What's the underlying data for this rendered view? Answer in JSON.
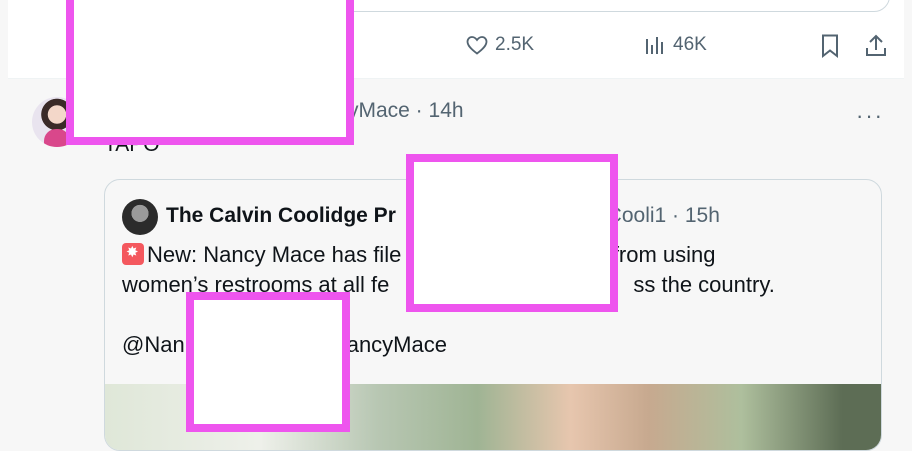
{
  "previous_post": {
    "likes": "2.5K",
    "views": "46K",
    "icons": [
      "heart-icon",
      "bar-chart-icon",
      "bookmark-icon",
      "share-icon"
    ]
  },
  "post": {
    "handle_time": "yMace · 14h",
    "text": "TAPO",
    "more": "···",
    "quoted": {
      "author_name": "The Calvin Coolidge Pr",
      "handle_time": "nCooli1 · 15h",
      "line1": "New: Nancy Mace has file",
      "line1_tail": "an men from using",
      "line2": "women’s restrooms at all fe",
      "line2_tail": "ss the country.",
      "line3": "@Nan",
      "line3_tail": "ancyMace"
    }
  },
  "colors": {
    "secondary_text": "#536471",
    "border": "#cfd9de",
    "redaction": "#ee55ee"
  }
}
